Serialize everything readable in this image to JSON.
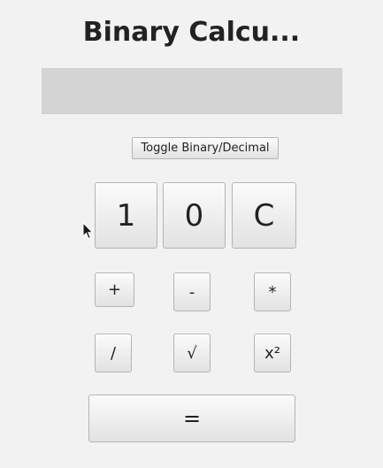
{
  "window": {
    "title": "Binary Calcu..."
  },
  "display": {
    "value": ""
  },
  "controls": {
    "toggle_label": "Toggle Binary/Decimal"
  },
  "digits": {
    "one": "1",
    "zero": "0",
    "clear": "C"
  },
  "operators": {
    "add": "+",
    "subtract": "-",
    "multiply": "*",
    "divide": "/",
    "sqrt": "√",
    "square": "x²"
  },
  "equals": {
    "label": "="
  },
  "colors": {
    "background": "#f2f2f2",
    "display_background": "#d4d4d4",
    "button_border": "#b4b4b4",
    "text": "#222222"
  },
  "icons": {
    "cursor": "mouse-pointer-icon"
  }
}
